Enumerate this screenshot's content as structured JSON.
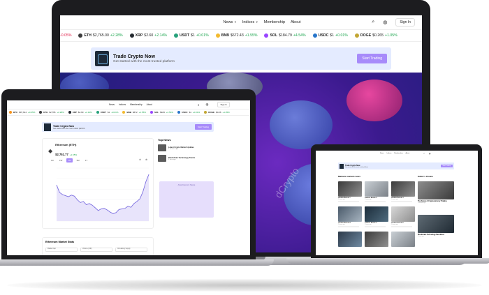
{
  "site": {
    "nav": {
      "links": [
        {
          "label": "News"
        },
        {
          "label": "Indices"
        },
        {
          "label": "Membership"
        },
        {
          "label": "About"
        }
      ],
      "signin": "Sign In",
      "icons": [
        "search-icon",
        "globe-icon"
      ]
    },
    "ticker": [
      {
        "symbol": "",
        "price": "",
        "change": "-0.05%",
        "dir": "down",
        "color": "#e11d48"
      },
      {
        "symbol": "ETH",
        "price": "$2,765.00",
        "change": "+2.28%",
        "dir": "up",
        "color": "#3c3c3d"
      },
      {
        "symbol": "XRP",
        "price": "$2.60",
        "change": "+2.14%",
        "dir": "up",
        "color": "#23292f"
      },
      {
        "symbol": "USDT",
        "price": "$1",
        "change": "+0.01%",
        "dir": "up",
        "color": "#26a17b"
      },
      {
        "symbol": "BNB",
        "price": "$672.43",
        "change": "+1.55%",
        "dir": "up",
        "color": "#f3ba2f"
      },
      {
        "symbol": "SOL",
        "price": "$184.79",
        "change": "+4.54%",
        "dir": "up",
        "color": "#9945ff"
      },
      {
        "symbol": "USDC",
        "price": "$1",
        "change": "+0.01%",
        "dir": "up",
        "color": "#2775ca"
      },
      {
        "symbol": "DOGE",
        "price": "$0.265",
        "change": "+1.05%",
        "dir": "up",
        "color": "#c2a633"
      }
    ],
    "banner": {
      "title": "Trade Crypto Now",
      "subtitle": "Get started with the most trusted platform",
      "cta": "Start Trading"
    },
    "hero": {
      "watermark": "dCrypto"
    }
  },
  "medium": {
    "nav": {
      "links": [
        "News",
        "Indices",
        "Membership",
        "About"
      ],
      "signin": "Sign In"
    },
    "ticker": [
      {
        "symbol": "BTC",
        "price": "$97,614",
        "change": "+0.05%",
        "dir": "up",
        "color": "#f7931a"
      },
      {
        "symbol": "ETH",
        "price": "$2,765",
        "change": "+2.28%",
        "dir": "up",
        "color": "#3c3c3d"
      },
      {
        "symbol": "XRP",
        "price": "$2.60",
        "change": "+2.14%",
        "dir": "up",
        "color": "#23292f"
      },
      {
        "symbol": "USDT",
        "price": "$1",
        "change": "+0.01%",
        "dir": "up",
        "color": "#26a17b"
      },
      {
        "symbol": "BNB",
        "price": "$672",
        "change": "+1.55%",
        "dir": "up",
        "color": "#f3ba2f"
      },
      {
        "symbol": "SOL",
        "price": "$184",
        "change": "+4.54%",
        "dir": "up",
        "color": "#9945ff"
      },
      {
        "symbol": "USDC",
        "price": "$1",
        "change": "+0.01%",
        "dir": "up",
        "color": "#2775ca"
      },
      {
        "symbol": "DOGE",
        "price": "$0.26",
        "change": "+1.05%",
        "dir": "up",
        "color": "#c2a633"
      }
    ],
    "banner": {
      "title": "Trade Crypto Now",
      "subtitle": "Get started with the most trusted platform",
      "cta": "Start Trading"
    },
    "coin": {
      "name": "Ethereum (ETH)",
      "price": "$2,751.77",
      "change": "+1.65%"
    },
    "range_tabs": [
      "1D",
      "1W",
      "1M",
      "3M",
      "1Y"
    ],
    "active_range": "1M",
    "chart_data": {
      "type": "area",
      "values": [
        0.68,
        0.54,
        0.5,
        0.48,
        0.46,
        0.49,
        0.47,
        0.4,
        0.35,
        0.37,
        0.31,
        0.33,
        0.3,
        0.25,
        0.2,
        0.23,
        0.24,
        0.21,
        0.17,
        0.14,
        0.16,
        0.22,
        0.23,
        0.24,
        0.28,
        0.26,
        0.33,
        0.37,
        0.42,
        0.55,
        0.74,
        0.88
      ],
      "ylim": [
        0,
        1
      ],
      "grid": true,
      "line_color": "#7c6fe0",
      "fill_color": "#e8e4fb"
    },
    "top_news": {
      "heading": "Top News",
      "items": [
        {
          "title": "Latest Crypto Market Updates",
          "meta": "5 minutes ago"
        },
        {
          "title": "Blockchain Technology Trends",
          "meta": "1 hour ago"
        }
      ]
    },
    "ad": {
      "label": "Advertisement Space"
    },
    "stats": {
      "heading": "Ethereum Market Stats",
      "pills": [
        "Market Cap",
        "Volume (24h)",
        "Circulating Supply"
      ]
    }
  },
  "small": {
    "nav": {
      "links": [
        "News",
        "Indices",
        "Membership",
        "About"
      ]
    },
    "banner": {
      "title": "Trade Crypto Now",
      "subtitle": "Get started with the most trusted platform",
      "cta": "Start Trading"
    },
    "section": "Markets markets news",
    "editors": "Editor's Choice",
    "cards": [
      {
        "title": "markets Article 1",
        "meta": "2 hours ago",
        "img": "img-c"
      },
      {
        "title": "markets Article 2",
        "meta": "2 hours ago",
        "img": "img-b"
      },
      {
        "title": "markets Article 3",
        "meta": "2 hours ago",
        "img": "img-c"
      },
      {
        "title": "markets Article 4",
        "meta": "2 hours ago",
        "img": "img-d"
      },
      {
        "title": "markets Article 5",
        "meta": "2 hours ago",
        "img": "img-e"
      },
      {
        "title": "markets Article 6",
        "meta": "2 hours ago",
        "img": "img-f"
      },
      {
        "title": "",
        "meta": "",
        "img": "img-a"
      },
      {
        "title": "",
        "meta": "",
        "img": "img-c"
      },
      {
        "title": "",
        "meta": "",
        "img": "img-b"
      }
    ],
    "editor_items": [
      {
        "title": "The Future of Cryptocurrency Trading",
        "meta": "5 minutes ago"
      },
      {
        "title": "Blockchain Technology Revolution",
        "meta": "1 hour ago"
      }
    ]
  }
}
